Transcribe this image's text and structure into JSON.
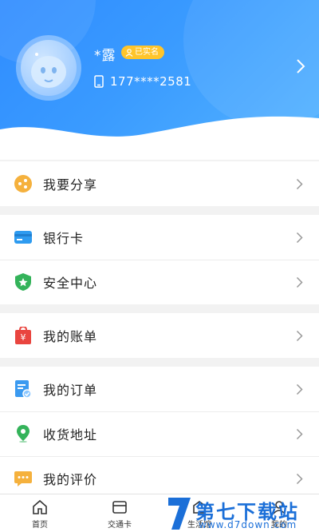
{
  "profile": {
    "username": "*露",
    "verified_label": "已实名",
    "phone": "177****2581"
  },
  "menu": {
    "share": "我要分享",
    "bank_card": "银行卡",
    "security": "安全中心",
    "bills": "我的账单",
    "orders": "我的订单",
    "address": "收货地址",
    "reviews": "我的评价"
  },
  "bottom_nav": {
    "home": "首页",
    "transit_card": "交通卡",
    "life": "生活馆",
    "mine": "我的"
  },
  "watermark": {
    "title": "第七下载站",
    "url": "www.d7down.com"
  },
  "colors": {
    "header_blue": "#2f8cff",
    "verified_badge": "#ffc52b"
  }
}
